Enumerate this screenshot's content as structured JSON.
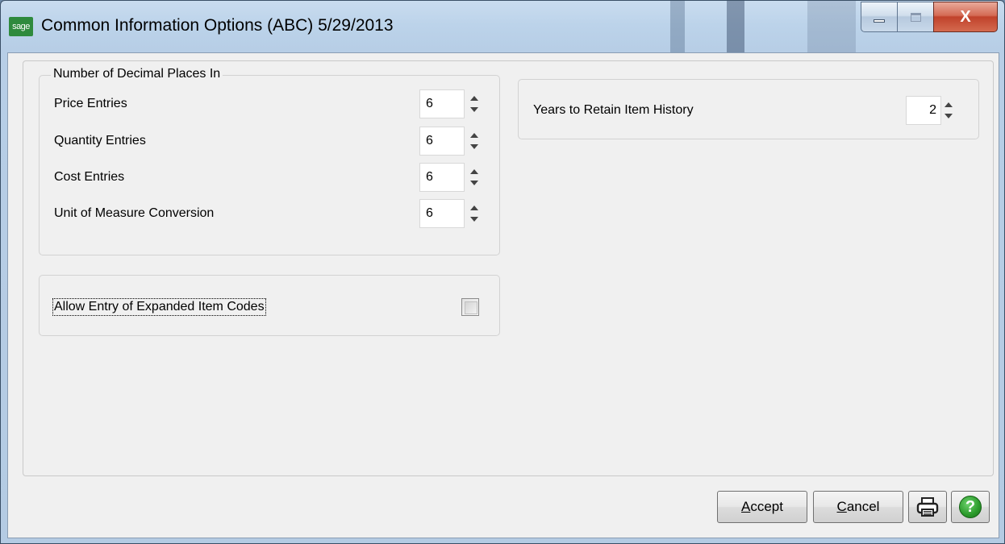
{
  "window": {
    "title": "Common Information Options (ABC) 5/29/2013",
    "app_icon_text": "sage",
    "close_glyph": "X"
  },
  "decimal_places": {
    "legend": "Number of Decimal Places In",
    "rows": [
      {
        "label": "Price Entries",
        "value": "6"
      },
      {
        "label": "Quantity Entries",
        "value": "6"
      },
      {
        "label": "Cost Entries",
        "value": "6"
      },
      {
        "label": "Unit of Measure Conversion",
        "value": "6"
      }
    ]
  },
  "history": {
    "label": "Years to Retain Item History",
    "value": "2"
  },
  "expanded_codes": {
    "label": "Allow Entry of Expanded Item Codes",
    "checked": false
  },
  "buttons": {
    "accept": {
      "mnemonic": "A",
      "rest": "ccept"
    },
    "cancel": {
      "mnemonic": "C",
      "rest": "ancel"
    },
    "print_icon": "printer-icon",
    "help_icon": "help-icon",
    "help_glyph": "?"
  },
  "colors": {
    "titlebar": "#bcd3ea",
    "close_button": "#c0422b",
    "help_green": "#2a9a2a"
  }
}
